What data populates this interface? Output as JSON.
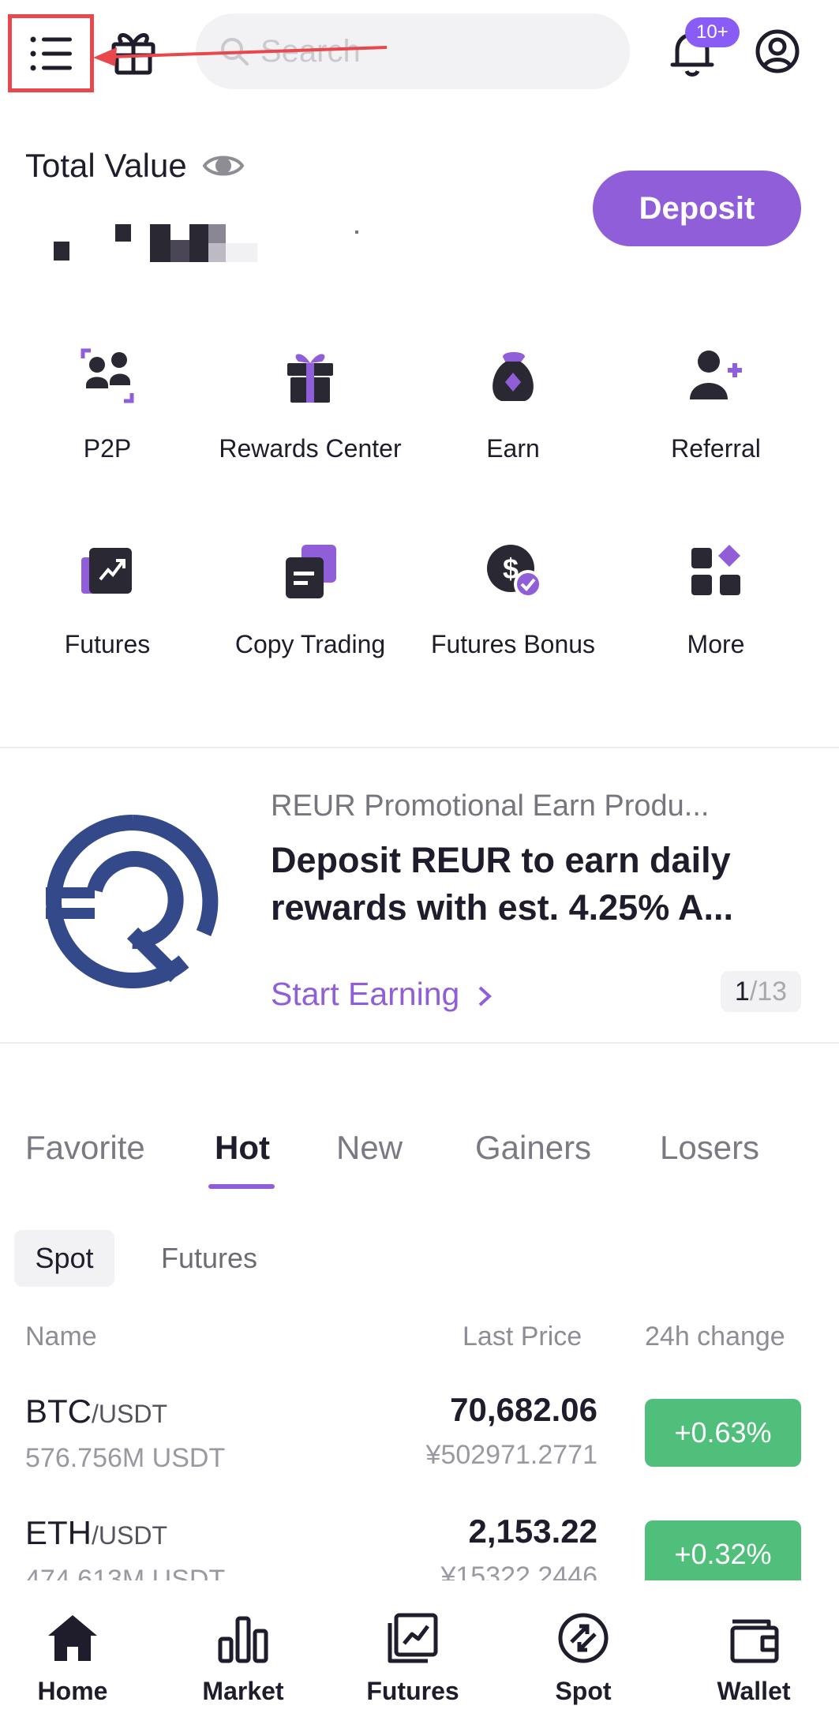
{
  "header": {
    "menu_icon": "hamburger-menu-icon",
    "gift_icon": "gift-icon",
    "search": {
      "placeholder": "Search"
    },
    "notifications": {
      "icon": "bell-icon",
      "badge": "10+"
    },
    "profile_icon": "user-circle-icon"
  },
  "account": {
    "total_label": "Total Value",
    "visibility_icon": "eye-icon",
    "deposit_label": "Deposit"
  },
  "quick_actions": [
    {
      "label": "P2P",
      "icon": "p2p-icon"
    },
    {
      "label": "Rewards Center",
      "icon": "gift-box-icon"
    },
    {
      "label": "Earn",
      "icon": "money-bag-icon"
    },
    {
      "label": "Referral",
      "icon": "add-user-icon"
    },
    {
      "label": "Futures",
      "icon": "futures-chart-icon"
    },
    {
      "label": "Copy Trading",
      "icon": "copy-trading-icon"
    },
    {
      "label": "Futures Bonus",
      "icon": "dollar-check-icon"
    },
    {
      "label": "More",
      "icon": "grid-more-icon"
    }
  ],
  "banner": {
    "logo": "reur-logo",
    "subtitle": "REUR Promotional Earn Produ...",
    "title": "Deposit REUR to earn daily rewards with est. 4.25% A...",
    "cta": "Start Earning",
    "pager_current": "1",
    "pager_total": "/13"
  },
  "market_tabs": [
    {
      "label": "Favorite",
      "active": false
    },
    {
      "label": "Hot",
      "active": true
    },
    {
      "label": "New",
      "active": false
    },
    {
      "label": "Gainers",
      "active": false
    },
    {
      "label": "Losers",
      "active": false
    }
  ],
  "segments": {
    "spot": "Spot",
    "futures": "Futures"
  },
  "columns": {
    "name": "Name",
    "last_price": "Last Price",
    "change": "24h change"
  },
  "rows": [
    {
      "coin": "BTC",
      "pair": "/USDT",
      "volume": "576.756M USDT",
      "price": "70,682.06",
      "fiat": "¥502971.2771",
      "change": "+0.63%"
    },
    {
      "coin": "ETH",
      "pair": "/USDT",
      "volume": "474.613M USDT",
      "price": "2,153.22",
      "fiat": "¥15322.2446",
      "change": "+0.32%"
    }
  ],
  "bottom_nav": [
    {
      "label": "Home",
      "icon": "home-icon"
    },
    {
      "label": "Market",
      "icon": "bar-chart-icon"
    },
    {
      "label": "Futures",
      "icon": "futures-icon"
    },
    {
      "label": "Spot",
      "icon": "spot-exchange-icon"
    },
    {
      "label": "Wallet",
      "icon": "wallet-icon"
    }
  ],
  "colors": {
    "accent": "#8f5ed8",
    "positive": "#4fbf7b",
    "annotation": "#e8474c",
    "text": "#1f1d2b"
  }
}
